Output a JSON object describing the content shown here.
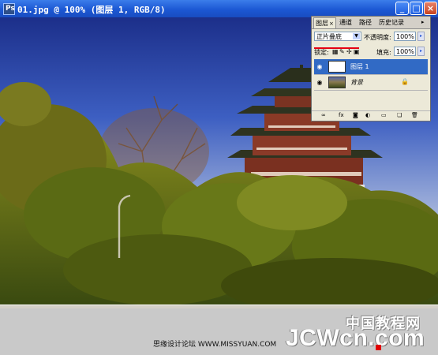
{
  "window": {
    "doc_icon": "Ps",
    "title": "01.jpg @ 100% (图层 1, RGB/8)",
    "minimize": "_",
    "maximize": "□",
    "close": "×"
  },
  "layers_panel": {
    "tabs": [
      {
        "label": "图层",
        "close": "×"
      },
      {
        "label": "通道"
      },
      {
        "label": "路径"
      },
      {
        "label": "历史记录"
      }
    ],
    "menu_arrow": "▸",
    "blend_mode": "正片叠底",
    "opacity_label": "不透明度:",
    "opacity_value": "100%",
    "lock_label": "锁定:",
    "fill_label": "填充:",
    "fill_value": "100%",
    "layers": [
      {
        "name": "图层 1",
        "selected": true
      },
      {
        "name": "背景",
        "selected": false,
        "locked": true
      }
    ],
    "bottom_icons": [
      "link-icon",
      "fx-icon",
      "mask-icon",
      "adjustment-icon",
      "group-icon",
      "new-layer-icon",
      "trash-icon"
    ]
  },
  "watermark": {
    "site_text": "思缘设计论坛 WWW.MISSYUAN.COM",
    "brand_cn": "中国教程网",
    "brand_logo": "JCWcn.com"
  },
  "colors": {
    "title_blue": "#1c58d4",
    "selection_blue": "#316ac5",
    "underline_red": "#e60012"
  }
}
